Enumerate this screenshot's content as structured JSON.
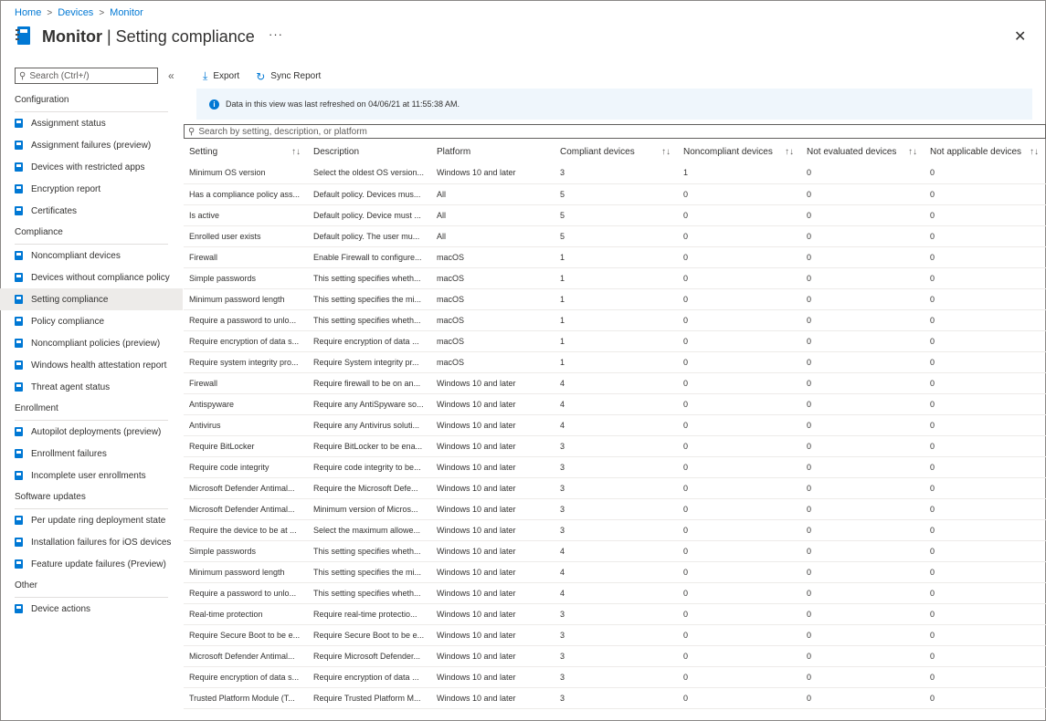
{
  "breadcrumb": [
    "Home",
    "Devices",
    "Monitor"
  ],
  "title": {
    "bold": "Monitor",
    "rest": " | Setting compliance"
  },
  "more": "···",
  "close": "✕",
  "sidebar": {
    "search_placeholder": "Search (Ctrl+/)",
    "collapse": "«",
    "sections": [
      {
        "title": "Configuration",
        "items": [
          "Assignment status",
          "Assignment failures (preview)",
          "Devices with restricted apps",
          "Encryption report",
          "Certificates"
        ]
      },
      {
        "title": "Compliance",
        "items": [
          "Noncompliant devices",
          "Devices without compliance policy",
          "Setting compliance",
          "Policy compliance",
          "Noncompliant policies (preview)",
          "Windows health attestation report",
          "Threat agent status"
        ]
      },
      {
        "title": "Enrollment",
        "items": [
          "Autopilot deployments (preview)",
          "Enrollment failures",
          "Incomplete user enrollments"
        ]
      },
      {
        "title": "Software updates",
        "items": [
          "Per update ring deployment state",
          "Installation failures for iOS devices",
          "Feature update failures (Preview)"
        ]
      },
      {
        "title": "Other",
        "items": [
          "Device actions"
        ]
      }
    ],
    "active_item": "Setting compliance"
  },
  "toolbar": {
    "export": "Export",
    "sync": "Sync Report"
  },
  "info": "Data in this view was last refreshed on 04/06/21 at 11:55:38 AM.",
  "table_search_placeholder": "Search by setting, description, or platform",
  "columns": [
    "Setting",
    "Description",
    "Platform",
    "Compliant devices",
    "Noncompliant devices",
    "Not evaluated devices",
    "Not applicable devices"
  ],
  "sortable": [
    true,
    false,
    false,
    true,
    true,
    true,
    true
  ],
  "rows": [
    [
      "Minimum OS version",
      "Select the oldest OS version...",
      "Windows 10 and later",
      "3",
      "1",
      "0",
      "0"
    ],
    [
      "Has a compliance policy ass...",
      "Default policy. Devices mus...",
      "All",
      "5",
      "0",
      "0",
      "0"
    ],
    [
      "Is active",
      "Default policy. Device must ...",
      "All",
      "5",
      "0",
      "0",
      "0"
    ],
    [
      "Enrolled user exists",
      "Default policy. The user mu...",
      "All",
      "5",
      "0",
      "0",
      "0"
    ],
    [
      "Firewall",
      "Enable Firewall to configure...",
      "macOS",
      "1",
      "0",
      "0",
      "0"
    ],
    [
      "Simple passwords",
      "This setting specifies wheth...",
      "macOS",
      "1",
      "0",
      "0",
      "0"
    ],
    [
      "Minimum password length",
      "This setting specifies the mi...",
      "macOS",
      "1",
      "0",
      "0",
      "0"
    ],
    [
      "Require a password to unlo...",
      "This setting specifies wheth...",
      "macOS",
      "1",
      "0",
      "0",
      "0"
    ],
    [
      "Require encryption of data s...",
      "Require encryption of data ...",
      "macOS",
      "1",
      "0",
      "0",
      "0"
    ],
    [
      "Require system integrity pro...",
      "Require System integrity pr...",
      "macOS",
      "1",
      "0",
      "0",
      "0"
    ],
    [
      "Firewall",
      "Require firewall to be on an...",
      "Windows 10 and later",
      "4",
      "0",
      "0",
      "0"
    ],
    [
      "Antispyware",
      "Require any AntiSpyware so...",
      "Windows 10 and later",
      "4",
      "0",
      "0",
      "0"
    ],
    [
      "Antivirus",
      "Require any Antivirus soluti...",
      "Windows 10 and later",
      "4",
      "0",
      "0",
      "0"
    ],
    [
      "Require BitLocker",
      "Require BitLocker to be ena...",
      "Windows 10 and later",
      "3",
      "0",
      "0",
      "0"
    ],
    [
      "Require code integrity",
      "Require code integrity to be...",
      "Windows 10 and later",
      "3",
      "0",
      "0",
      "0"
    ],
    [
      "Microsoft Defender Antimal...",
      "Require the Microsoft Defe...",
      "Windows 10 and later",
      "3",
      "0",
      "0",
      "0"
    ],
    [
      "Microsoft Defender Antimal...",
      "Minimum version of Micros...",
      "Windows 10 and later",
      "3",
      "0",
      "0",
      "0"
    ],
    [
      "Require the device to be at ...",
      "Select the maximum allowe...",
      "Windows 10 and later",
      "3",
      "0",
      "0",
      "0"
    ],
    [
      "Simple passwords",
      "This setting specifies wheth...",
      "Windows 10 and later",
      "4",
      "0",
      "0",
      "0"
    ],
    [
      "Minimum password length",
      "This setting specifies the mi...",
      "Windows 10 and later",
      "4",
      "0",
      "0",
      "0"
    ],
    [
      "Require a password to unlo...",
      "This setting specifies wheth...",
      "Windows 10 and later",
      "4",
      "0",
      "0",
      "0"
    ],
    [
      "Real-time protection",
      "Require real-time protectio...",
      "Windows 10 and later",
      "3",
      "0",
      "0",
      "0"
    ],
    [
      "Require Secure Boot to be e...",
      "Require Secure Boot to be e...",
      "Windows 10 and later",
      "3",
      "0",
      "0",
      "0"
    ],
    [
      "Microsoft Defender Antimal...",
      "Require Microsoft Defender...",
      "Windows 10 and later",
      "3",
      "0",
      "0",
      "0"
    ],
    [
      "Require encryption of data s...",
      "Require encryption of data ...",
      "Windows 10 and later",
      "3",
      "0",
      "0",
      "0"
    ],
    [
      "Trusted Platform Module (T...",
      "Require Trusted Platform M...",
      "Windows 10 and later",
      "3",
      "0",
      "0",
      "0"
    ]
  ],
  "colors": {
    "accent": "#0078d4",
    "active_bg": "#edebe9",
    "info_bg": "#eff6fc"
  }
}
